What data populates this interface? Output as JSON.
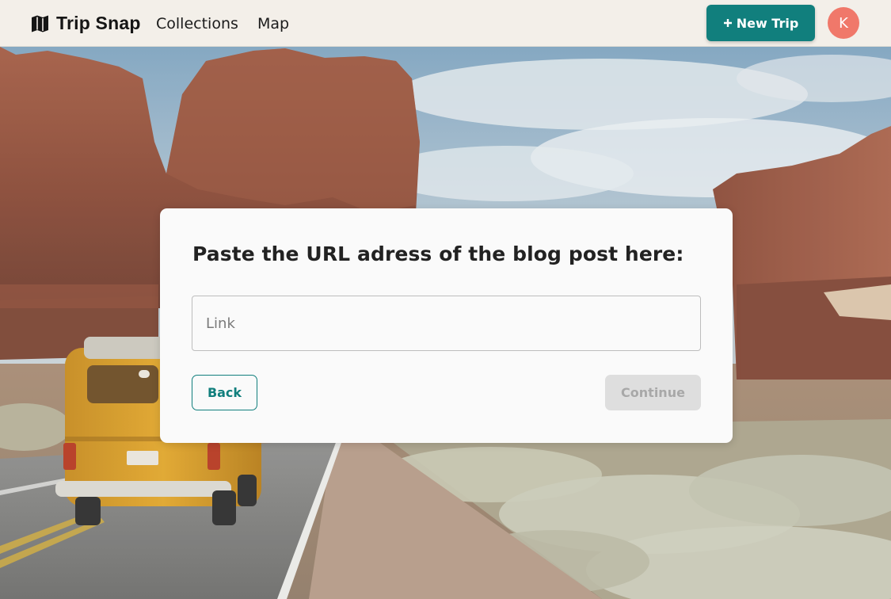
{
  "header": {
    "brand_name": "Trip Snap",
    "brand_icon": "map-icon",
    "nav": [
      {
        "label": "Collections"
      },
      {
        "label": "Map"
      }
    ],
    "new_trip_label": "New Trip",
    "new_trip_icon": "plus-icon",
    "avatar_initial": "K"
  },
  "modal": {
    "title": "Paste the URL adress of the blog post here:",
    "input": {
      "placeholder": "Link",
      "value": ""
    },
    "back_label": "Back",
    "continue_label": "Continue"
  },
  "colors": {
    "accent": "#117f7d",
    "avatar": "#f0786a",
    "header_bg": "#f3efe9",
    "disabled_bg": "#dedede"
  }
}
